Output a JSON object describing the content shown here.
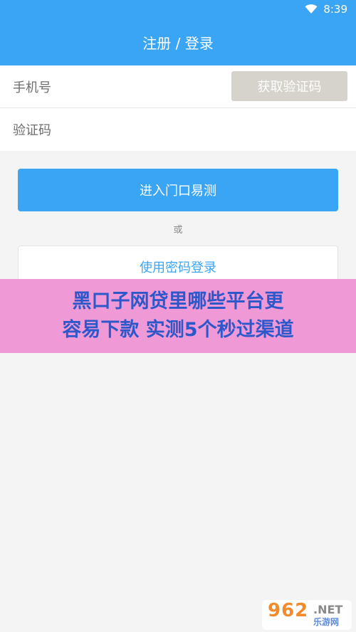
{
  "status_bar": {
    "time": "8:39",
    "wifi_icon": "wifi-icon"
  },
  "header": {
    "title": "注册 / 登录"
  },
  "form": {
    "phone_placeholder": "手机号",
    "code_placeholder": "验证码",
    "get_code_label": "获取验证码"
  },
  "actions": {
    "primary_label": "进入门口易测",
    "or_text": "或",
    "password_login_label": "使用密码登录"
  },
  "overlay_banner": {
    "line1": "黑口子网贷里哪些平台更",
    "line2": "容易下款 实测5个秒过渠道"
  },
  "watermark": {
    "number": "962",
    "domain": ".NET",
    "sub": "乐游网"
  },
  "colors": {
    "accent": "#3aa4f5",
    "disabled_button": "#d6d2cc",
    "banner_bg": "#f099d7",
    "banner_text": "#2d58c9",
    "background": "#f4f4f4"
  }
}
